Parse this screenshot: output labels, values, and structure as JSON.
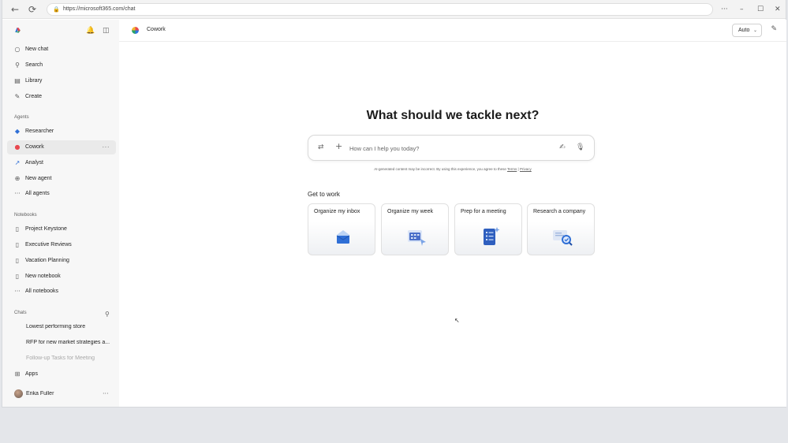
{
  "browser": {
    "url": "https://microsoft365.com/chat",
    "back_glyph": "←",
    "refresh_glyph": "⟳",
    "lock_glyph": "🔒",
    "more_glyph": "···",
    "minimize_glyph": "–",
    "maximize_glyph": "☐",
    "close_glyph": "✕"
  },
  "sidebar": {
    "bell_glyph": "🔔",
    "panel_glyph": "◫",
    "nav": [
      {
        "label": "New chat",
        "icon": "chat-bubble-icon",
        "glyph": "○"
      },
      {
        "label": "Search",
        "icon": "search-icon",
        "glyph": "⚲"
      },
      {
        "label": "Library",
        "icon": "library-icon",
        "glyph": "▤"
      },
      {
        "label": "Create",
        "icon": "create-icon",
        "glyph": "✎"
      }
    ],
    "agents_heading": "Agents",
    "agents": [
      {
        "label": "Researcher",
        "icon": "researcher-icon",
        "glyph": "◆"
      },
      {
        "label": "Cowork",
        "icon": "cowork-icon",
        "glyph": "●",
        "more": "···"
      },
      {
        "label": "Analyst",
        "icon": "analyst-icon",
        "glyph": "↗"
      },
      {
        "label": "New agent",
        "icon": "new-agent-icon",
        "glyph": "⊕"
      },
      {
        "label": "All agents",
        "icon": "more-icon",
        "glyph": "···"
      }
    ],
    "notebooks_heading": "Notebooks",
    "notebooks": [
      {
        "label": "Project Keystone",
        "icon": "notebook-icon",
        "glyph": "▯"
      },
      {
        "label": "Executive Reviews",
        "icon": "notebook-icon",
        "glyph": "▯"
      },
      {
        "label": "Vacation Planning",
        "icon": "notebook-icon",
        "glyph": "▯"
      },
      {
        "label": "New notebook",
        "icon": "new-notebook-icon",
        "glyph": "▯"
      },
      {
        "label": "All notebooks",
        "icon": "more-icon",
        "glyph": "···"
      }
    ],
    "chats_heading": "Chats",
    "chats_search_glyph": "⚲",
    "chats": [
      {
        "label": "Lowest performing store"
      },
      {
        "label": "RFP for new market strategies a..."
      },
      {
        "label": "Follow-up Tasks for Meeting"
      }
    ],
    "apps": {
      "label": "Apps",
      "icon": "apps-icon",
      "glyph": "⊞"
    },
    "user": {
      "name": "Erika Fuller",
      "more": "···"
    }
  },
  "header": {
    "title": "Cowork",
    "mode_label": "Auto",
    "chevron_glyph": "⌄",
    "edit_glyph": "✎"
  },
  "main": {
    "headline": "What should we tackle next?",
    "composer": {
      "placeholder": "How can I help you today?",
      "tools_glyph": "⇄",
      "add_glyph": "+",
      "pen_glyph": "✍",
      "mic_glyph": "🎙"
    },
    "disclaimer": {
      "text": "AI-generated content may be incorrect. By using this experience, you agree to these",
      "terms": "Terms",
      "sep": "|",
      "privacy": "Privacy"
    },
    "get_to_work": "Get to work",
    "cards": [
      {
        "title": "Organize my inbox",
        "icon": "inbox-envelope-icon"
      },
      {
        "title": "Organize my week",
        "icon": "calendar-icon"
      },
      {
        "title": "Prep for a meeting",
        "icon": "checklist-icon"
      },
      {
        "title": "Research a company",
        "icon": "research-magnifier-icon"
      }
    ],
    "cursor_glyph": "↖"
  },
  "colors": {
    "accent_blue": "#2f6fd6",
    "sidebar_bg": "#f7f7f7",
    "page_bg": "#e4e6ea"
  }
}
